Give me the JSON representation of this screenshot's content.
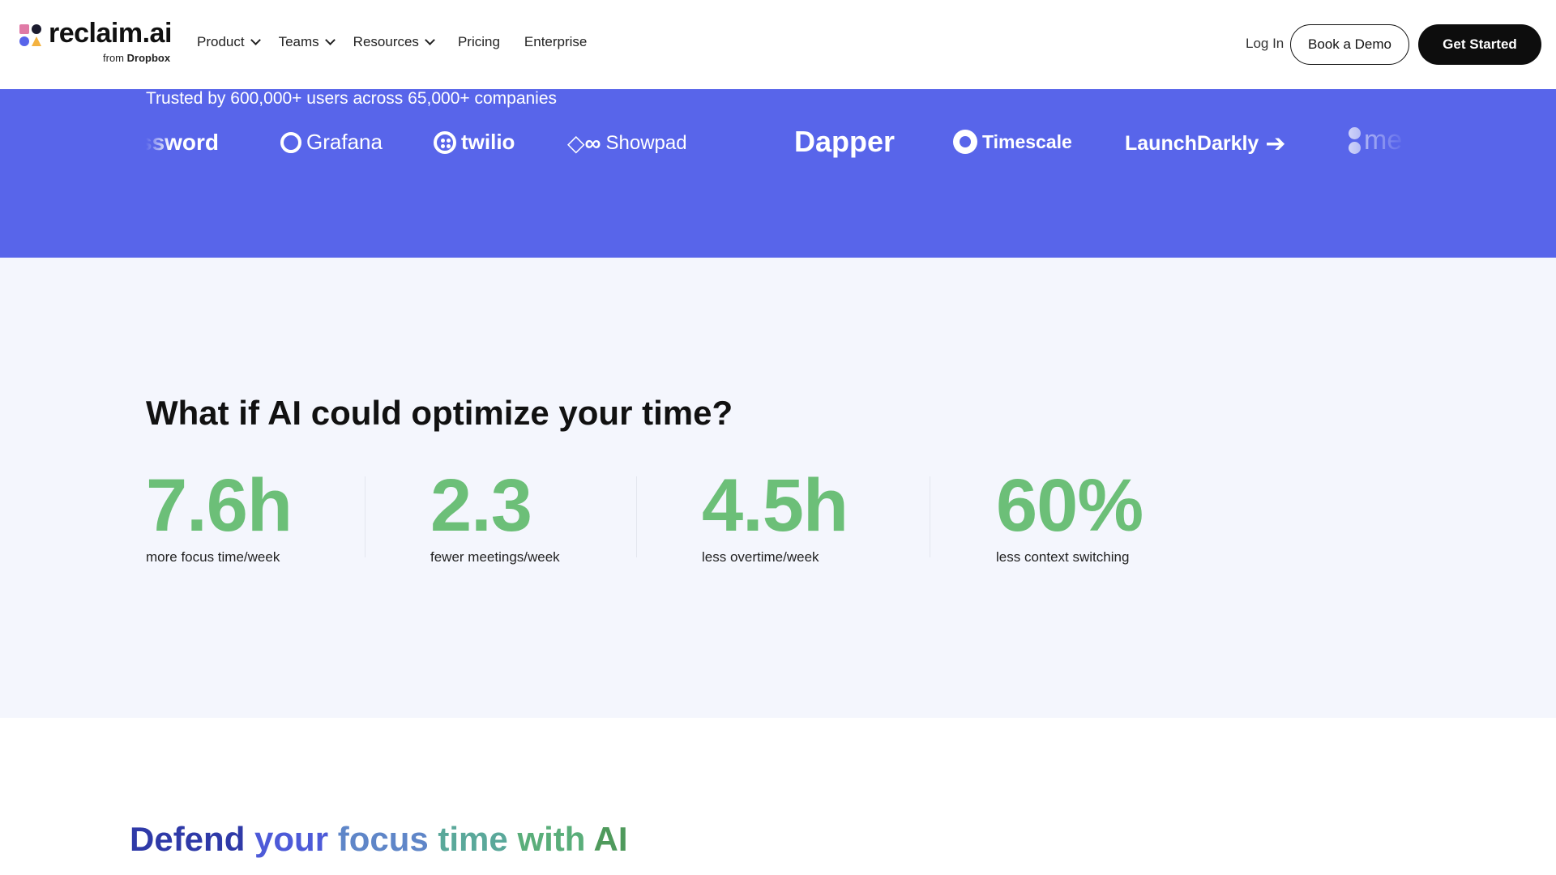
{
  "brand": {
    "name": "reclaim.ai",
    "sub_prefix": "from",
    "sub_brand": "Dropbox"
  },
  "nav": {
    "items": [
      {
        "label": "Product",
        "has_dropdown": true
      },
      {
        "label": "Teams",
        "has_dropdown": true
      },
      {
        "label": "Resources",
        "has_dropdown": true
      },
      {
        "label": "Pricing",
        "has_dropdown": false
      },
      {
        "label": "Enterprise",
        "has_dropdown": false
      }
    ],
    "login": "Log In",
    "demo": "Book a Demo",
    "start": "Get Started"
  },
  "band": {
    "trusted": "Trusted by 600,000+ users across 65,000+ companies",
    "logos": [
      "ssword",
      "Grafana",
      "twilio",
      "Showpad",
      "Dapper",
      "Timescale",
      "LaunchDarkly",
      "me"
    ]
  },
  "stats": {
    "title": "What if AI could optimize your time?",
    "items": [
      {
        "value": "7.6h",
        "label": "more focus time/week"
      },
      {
        "value": "2.3",
        "label": "fewer meetings/week"
      },
      {
        "value": "4.5h",
        "label": "less overtime/week"
      },
      {
        "value": "60%",
        "label": "less context switching"
      }
    ]
  },
  "defend": {
    "words": [
      "Defend",
      "your",
      "focus",
      "time",
      "with",
      "AI"
    ]
  },
  "colors": {
    "band": "#5865ea",
    "stat_green": "#6cbf78",
    "stats_bg": "#f4f6fd"
  }
}
